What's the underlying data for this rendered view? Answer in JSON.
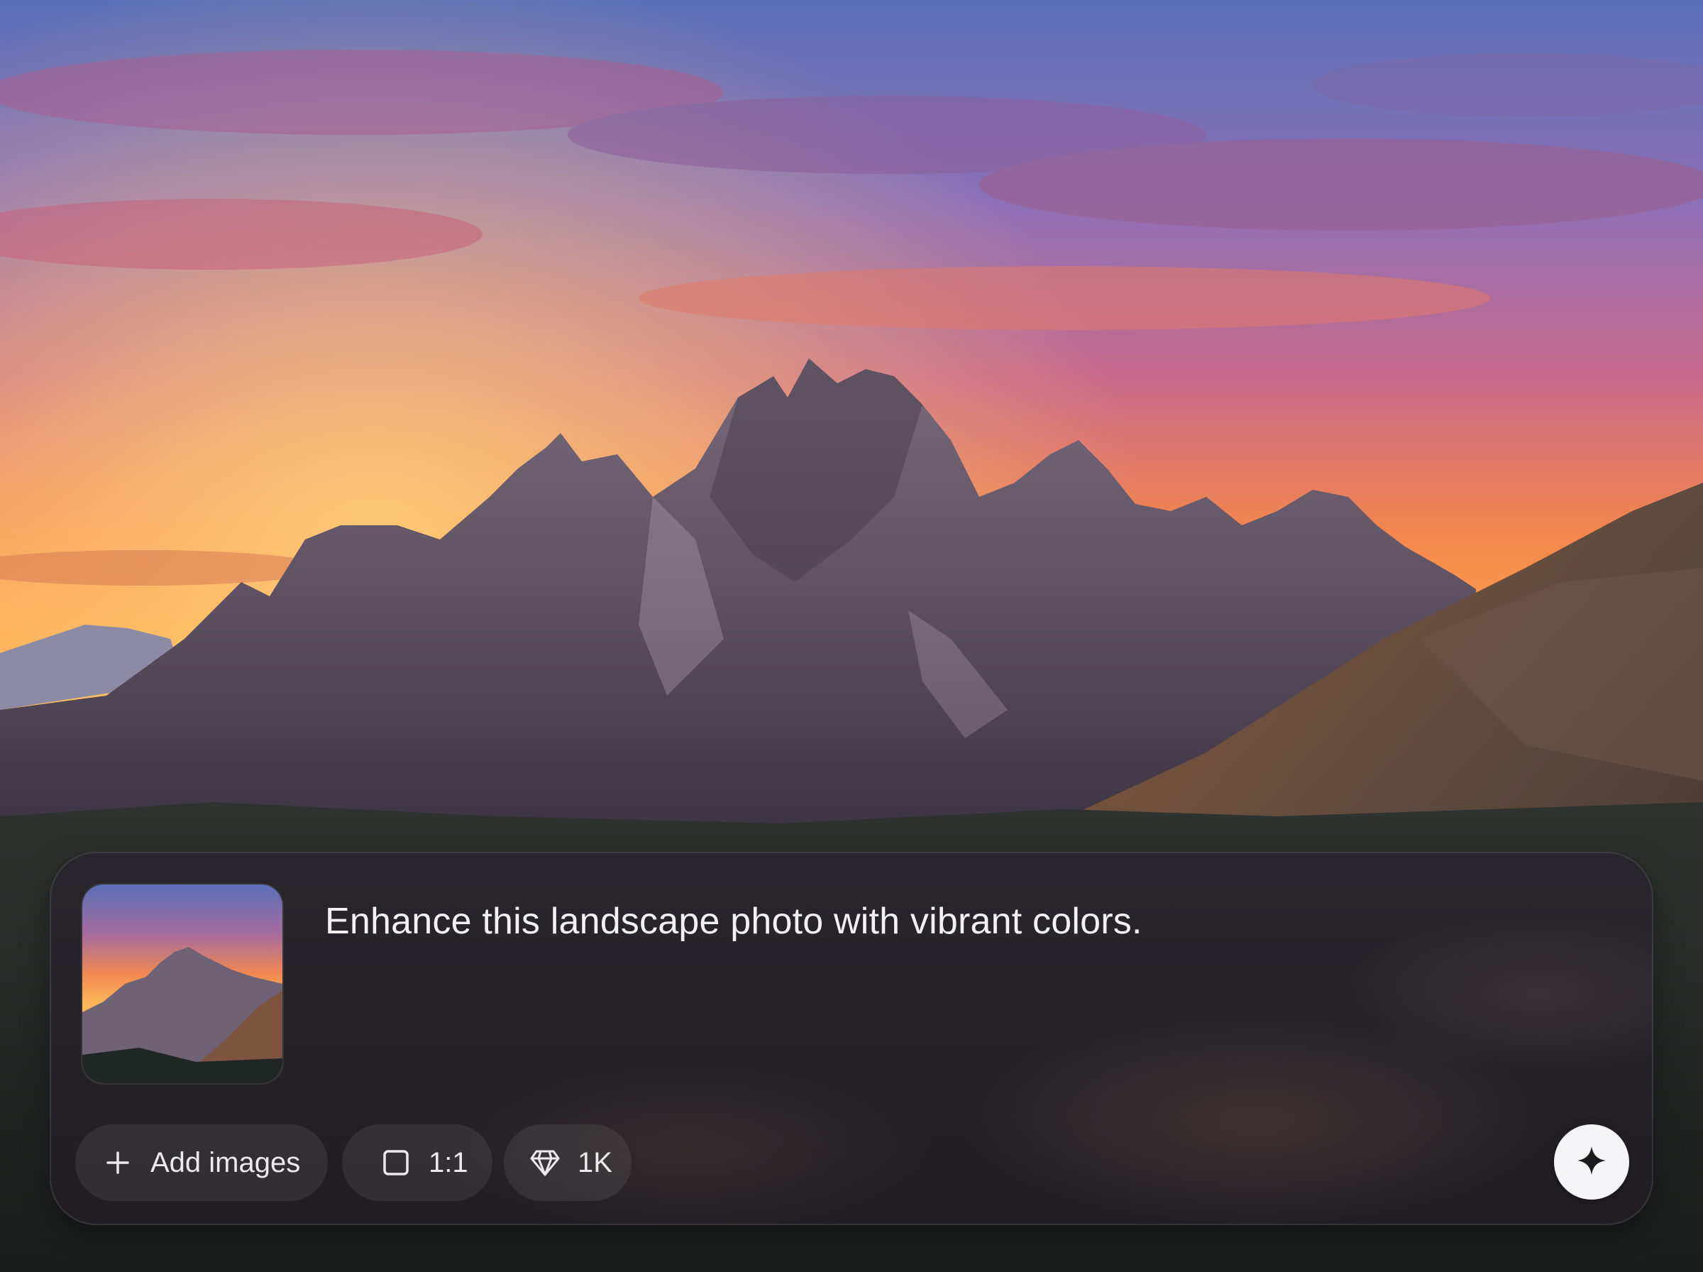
{
  "composer": {
    "prompt_text": "Enhance this landscape photo with vibrant colors.",
    "attachment": {
      "description": "landscape thumbnail"
    },
    "add_images_label": "Add images",
    "aspect_ratio_label": "1:1",
    "resolution_label": "1K",
    "icons": {
      "add": "plus-icon",
      "aspect": "square-icon",
      "resolution": "diamond-icon",
      "generate": "sparkle-icon"
    }
  },
  "colors": {
    "panel_bg": "#28242c",
    "chip_bg": "#3a363e",
    "text": "#f2f0f2",
    "button_bg": "#f4f3f5",
    "button_icon": "#1a1a1c"
  }
}
